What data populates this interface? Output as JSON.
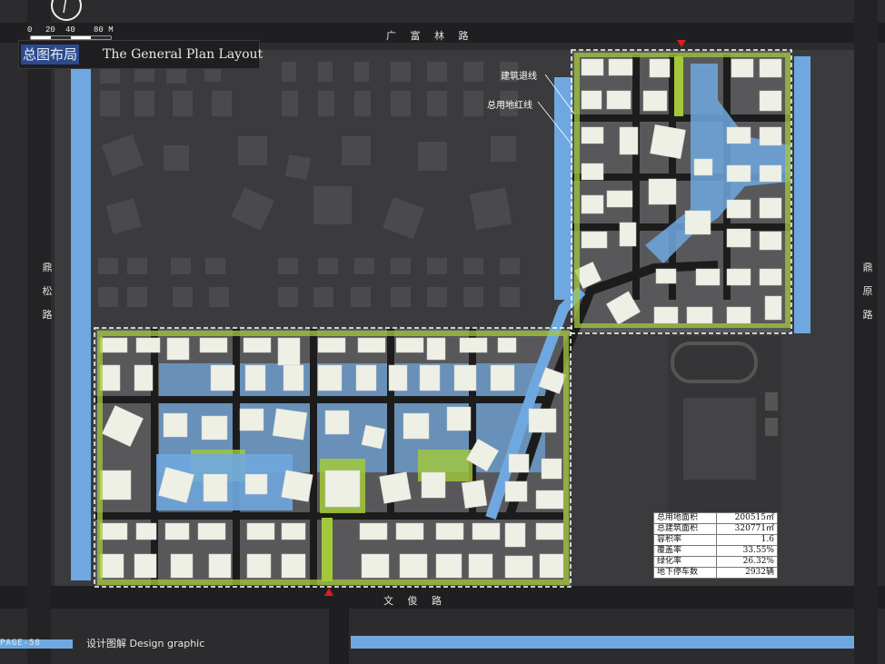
{
  "title": {
    "cn": "总图布局",
    "en": "The General Plan Layout"
  },
  "scale_bar": {
    "ticks": [
      "0",
      "20",
      "40",
      "80 M"
    ]
  },
  "roads": {
    "north": "广 富 林 路",
    "south": "文 俊 路",
    "west": [
      "鼎",
      "松",
      "路"
    ],
    "east": [
      "鼎",
      "原",
      "路"
    ]
  },
  "callouts": {
    "setback_line": "建筑退线",
    "red_line": "总用地红线"
  },
  "stats": [
    {
      "label": "总用地面积",
      "value": "200515㎡"
    },
    {
      "label": "总建筑面积",
      "value": "320771㎡"
    },
    {
      "label": "容积率",
      "value": "1.6"
    },
    {
      "label": "覆盖率",
      "value": "33.55%"
    },
    {
      "label": "绿化率",
      "value": "26.32%"
    },
    {
      "label": "地下停车数",
      "value": "2932辆"
    }
  ],
  "footer": {
    "page": "PAGE-58",
    "caption": "设计图解 Design graphic"
  },
  "colors": {
    "water": "#6fa8e0",
    "greenery": "#a3c93a",
    "site_boundary": "#ffffff",
    "background": "#2c2c2e"
  }
}
